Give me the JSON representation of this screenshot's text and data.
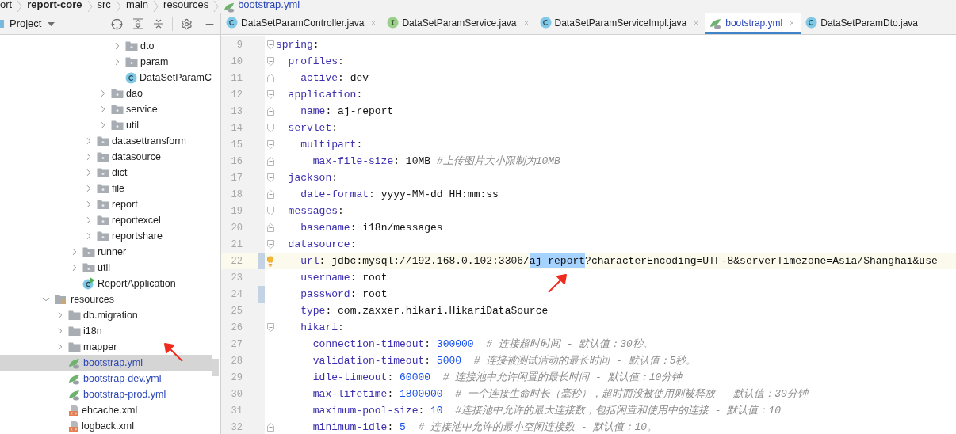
{
  "breadcrumb": [
    {
      "kind": "folder",
      "label": "ort"
    },
    {
      "kind": "module",
      "label": "report-core"
    },
    {
      "kind": "folder",
      "label": "src"
    },
    {
      "kind": "folder",
      "label": "main"
    },
    {
      "kind": "folder",
      "label": "resources"
    },
    {
      "kind": "file",
      "label": "bootstrap.yml"
    }
  ],
  "project_panel": {
    "title": "Project"
  },
  "tree": [
    {
      "children": [
        {
          "children": [
            {
              "children": [
                {
                  "children": [
                    {
                      "children": [
                        {
                          "kind": "package",
                          "label": "dto",
                          "expanded": false,
                          "selected": false
                        },
                        {
                          "kind": "package",
                          "label": "param",
                          "expanded": false,
                          "selected": false
                        },
                        {
                          "kind": "class",
                          "label": "DataSetParamC",
                          "selected": false
                        }
                      ]
                    },
                    {
                      "kind": "package",
                      "label": "dao",
                      "expanded": false,
                      "selected": false
                    },
                    {
                      "kind": "package",
                      "label": "service",
                      "expanded": false,
                      "selected": false
                    },
                    {
                      "kind": "package",
                      "label": "util",
                      "expanded": false,
                      "selected": false
                    }
                  ]
                },
                {
                  "kind": "package",
                  "label": "datasettransform",
                  "expanded": false,
                  "selected": false
                },
                {
                  "kind": "package",
                  "label": "datasource",
                  "expanded": false,
                  "selected": false
                },
                {
                  "kind": "package",
                  "label": "dict",
                  "expanded": false,
                  "selected": false
                },
                {
                  "kind": "package",
                  "label": "file",
                  "expanded": false,
                  "selected": false
                },
                {
                  "kind": "package",
                  "label": "report",
                  "expanded": false,
                  "selected": false
                },
                {
                  "kind": "package",
                  "label": "reportexcel",
                  "expanded": false,
                  "selected": false
                },
                {
                  "kind": "package",
                  "label": "reportshare",
                  "expanded": false,
                  "selected": false
                }
              ]
            },
            {
              "kind": "package",
              "label": "runner",
              "expanded": false,
              "selected": false
            },
            {
              "kind": "package",
              "label": "util",
              "expanded": false,
              "selected": false
            },
            {
              "kind": "app",
              "label": "ReportApplication",
              "selected": false
            }
          ]
        }
      ]
    },
    {
      "kind": "resources",
      "label": "resources",
      "expanded": true,
      "selected": false,
      "children": [
        {
          "kind": "folder",
          "label": "db.migration",
          "expanded": false,
          "selected": false
        },
        {
          "kind": "folder",
          "label": "i18n",
          "expanded": false,
          "selected": false
        },
        {
          "kind": "folder",
          "label": "mapper",
          "expanded": false,
          "selected": false
        },
        {
          "kind": "yml",
          "label": "bootstrap.yml",
          "selected": true
        },
        {
          "kind": "yml",
          "label": "bootstrap-dev.yml",
          "selected": false
        },
        {
          "kind": "yml",
          "label": "bootstrap-prod.yml",
          "selected": false
        },
        {
          "kind": "xml",
          "label": "ehcache.xml",
          "selected": false
        },
        {
          "kind": "xml",
          "label": "logback.xml",
          "selected": false
        }
      ]
    }
  ],
  "tabs": [
    {
      "kind": "class",
      "label": "DataSetParamController.java",
      "selected": false,
      "closable": true
    },
    {
      "kind": "interface",
      "label": "DataSetParamService.java",
      "selected": false,
      "closable": true
    },
    {
      "kind": "class",
      "label": "DataSetParamServiceImpl.java",
      "selected": false,
      "closable": true
    },
    {
      "kind": "yml",
      "label": "bootstrap.yml",
      "selected": true,
      "closable": true
    },
    {
      "kind": "class",
      "label": "DataSetParamDto.java",
      "selected": false,
      "closable": false
    }
  ],
  "code_lines": [
    {
      "number": "9",
      "fold_start": true,
      "tokens": [
        {
          "kind": "key",
          "text": "spring"
        },
        {
          "kind": "punct",
          "text": ":"
        }
      ]
    },
    {
      "number": "10",
      "fold_start": true,
      "tokens": [
        {
          "kind": "key",
          "text": "  profiles"
        },
        {
          "kind": "punct",
          "text": ":"
        }
      ]
    },
    {
      "number": "11",
      "fold_end": true,
      "tokens": [
        {
          "kind": "key",
          "text": "    active"
        },
        {
          "kind": "punct",
          "text": ": "
        },
        {
          "kind": "value",
          "text": "dev"
        }
      ]
    },
    {
      "number": "12",
      "fold_start": true,
      "tokens": [
        {
          "kind": "key",
          "text": "  application"
        },
        {
          "kind": "punct",
          "text": ":"
        }
      ]
    },
    {
      "number": "13",
      "fold_end": true,
      "tokens": [
        {
          "kind": "key",
          "text": "    name"
        },
        {
          "kind": "punct",
          "text": ": "
        },
        {
          "kind": "value",
          "text": "aj-report"
        }
      ]
    },
    {
      "number": "14",
      "fold_start": true,
      "tokens": [
        {
          "kind": "key",
          "text": "  servlet"
        },
        {
          "kind": "punct",
          "text": ":"
        }
      ]
    },
    {
      "number": "15",
      "fold_start": true,
      "tokens": [
        {
          "kind": "key",
          "text": "    multipart"
        },
        {
          "kind": "punct",
          "text": ":"
        }
      ]
    },
    {
      "number": "16",
      "fold_end": true,
      "tokens": [
        {
          "kind": "key",
          "text": "      max-file-size"
        },
        {
          "kind": "punct",
          "text": ": "
        },
        {
          "kind": "value",
          "text": "10MB"
        },
        {
          "kind": "comment",
          "text": " #上传图片大小限制为10MB"
        }
      ]
    },
    {
      "number": "17",
      "fold_start": true,
      "tokens": [
        {
          "kind": "key",
          "text": "  jackson"
        },
        {
          "kind": "punct",
          "text": ":"
        }
      ]
    },
    {
      "number": "18",
      "fold_end": true,
      "tokens": [
        {
          "kind": "key",
          "text": "    date-format"
        },
        {
          "kind": "punct",
          "text": ": "
        },
        {
          "kind": "value",
          "text": "yyyy-MM-dd HH:mm:ss"
        }
      ]
    },
    {
      "number": "19",
      "fold_start": true,
      "tokens": [
        {
          "kind": "key",
          "text": "  messages"
        },
        {
          "kind": "punct",
          "text": ":"
        }
      ]
    },
    {
      "number": "20",
      "fold_end": true,
      "tokens": [
        {
          "kind": "key",
          "text": "    basename"
        },
        {
          "kind": "punct",
          "text": ": "
        },
        {
          "kind": "value",
          "text": "i18n/messages"
        }
      ]
    },
    {
      "number": "21",
      "fold_start": true,
      "tokens": [
        {
          "kind": "key",
          "text": "  datasource"
        },
        {
          "kind": "punct",
          "text": ":"
        }
      ]
    },
    {
      "number": "22",
      "current": true,
      "changed": true,
      "hint": true,
      "tokens": [
        {
          "kind": "key",
          "text": "    url"
        },
        {
          "kind": "punct",
          "text": ": "
        },
        {
          "kind": "value",
          "text": "jdbc:mysql://192.168.0.102:3306/"
        },
        {
          "kind": "value",
          "text": "aj_report",
          "selected": true
        },
        {
          "kind": "value",
          "text": "?characterEncoding=UTF-8&serverTimezone=Asia/Shanghai&use"
        }
      ]
    },
    {
      "number": "23",
      "tokens": [
        {
          "kind": "key",
          "text": "    username"
        },
        {
          "kind": "punct",
          "text": ": "
        },
        {
          "kind": "value",
          "text": "root"
        }
      ]
    },
    {
      "number": "24",
      "changed": true,
      "tokens": [
        {
          "kind": "key",
          "text": "    password"
        },
        {
          "kind": "punct",
          "text": ": "
        },
        {
          "kind": "value",
          "text": "root"
        }
      ]
    },
    {
      "number": "25",
      "tokens": [
        {
          "kind": "key",
          "text": "    type"
        },
        {
          "kind": "punct",
          "text": ": "
        },
        {
          "kind": "value",
          "text": "com.zaxxer.hikari.HikariDataSource"
        }
      ]
    },
    {
      "number": "26",
      "fold_start": true,
      "tokens": [
        {
          "kind": "key",
          "text": "    hikari"
        },
        {
          "kind": "punct",
          "text": ":"
        }
      ]
    },
    {
      "number": "27",
      "tokens": [
        {
          "kind": "key",
          "text": "      connection-timeout"
        },
        {
          "kind": "punct",
          "text": ": "
        },
        {
          "kind": "number",
          "text": "300000"
        },
        {
          "kind": "comment",
          "text": "  # 连接超时时间 - 默认值：30秒。"
        }
      ]
    },
    {
      "number": "28",
      "tokens": [
        {
          "kind": "key",
          "text": "      validation-timeout"
        },
        {
          "kind": "punct",
          "text": ": "
        },
        {
          "kind": "number",
          "text": "5000"
        },
        {
          "kind": "comment",
          "text": "  # 连接被测试活动的最长时间 - 默认值：5秒。"
        }
      ]
    },
    {
      "number": "29",
      "tokens": [
        {
          "kind": "key",
          "text": "      idle-timeout"
        },
        {
          "kind": "punct",
          "text": ": "
        },
        {
          "kind": "number",
          "text": "60000"
        },
        {
          "kind": "comment",
          "text": "  # 连接池中允许闲置的最长时间 - 默认值：10分钟"
        }
      ]
    },
    {
      "number": "30",
      "tokens": [
        {
          "kind": "key",
          "text": "      max-lifetime"
        },
        {
          "kind": "punct",
          "text": ": "
        },
        {
          "kind": "number",
          "text": "1800000"
        },
        {
          "kind": "comment",
          "text": "  # 一个连接生命时长（毫秒），超时而没被使用则被释放 - 默认值：30分钟"
        }
      ]
    },
    {
      "number": "31",
      "tokens": [
        {
          "kind": "key",
          "text": "      maximum-pool-size"
        },
        {
          "kind": "punct",
          "text": ": "
        },
        {
          "kind": "number",
          "text": "10"
        },
        {
          "kind": "comment",
          "text": "  #连接池中允许的最大连接数，包括闲置和使用中的连接 - 默认值：10"
        }
      ]
    },
    {
      "number": "32",
      "fold_end": true,
      "tokens": [
        {
          "kind": "key",
          "text": "      minimum-idle"
        },
        {
          "kind": "punct",
          "text": ": "
        },
        {
          "kind": "number",
          "text": "5"
        },
        {
          "kind": "comment",
          "text": "  # 连接池中允许的最小空闲连接数 - 默认值：10。"
        }
      ]
    }
  ]
}
